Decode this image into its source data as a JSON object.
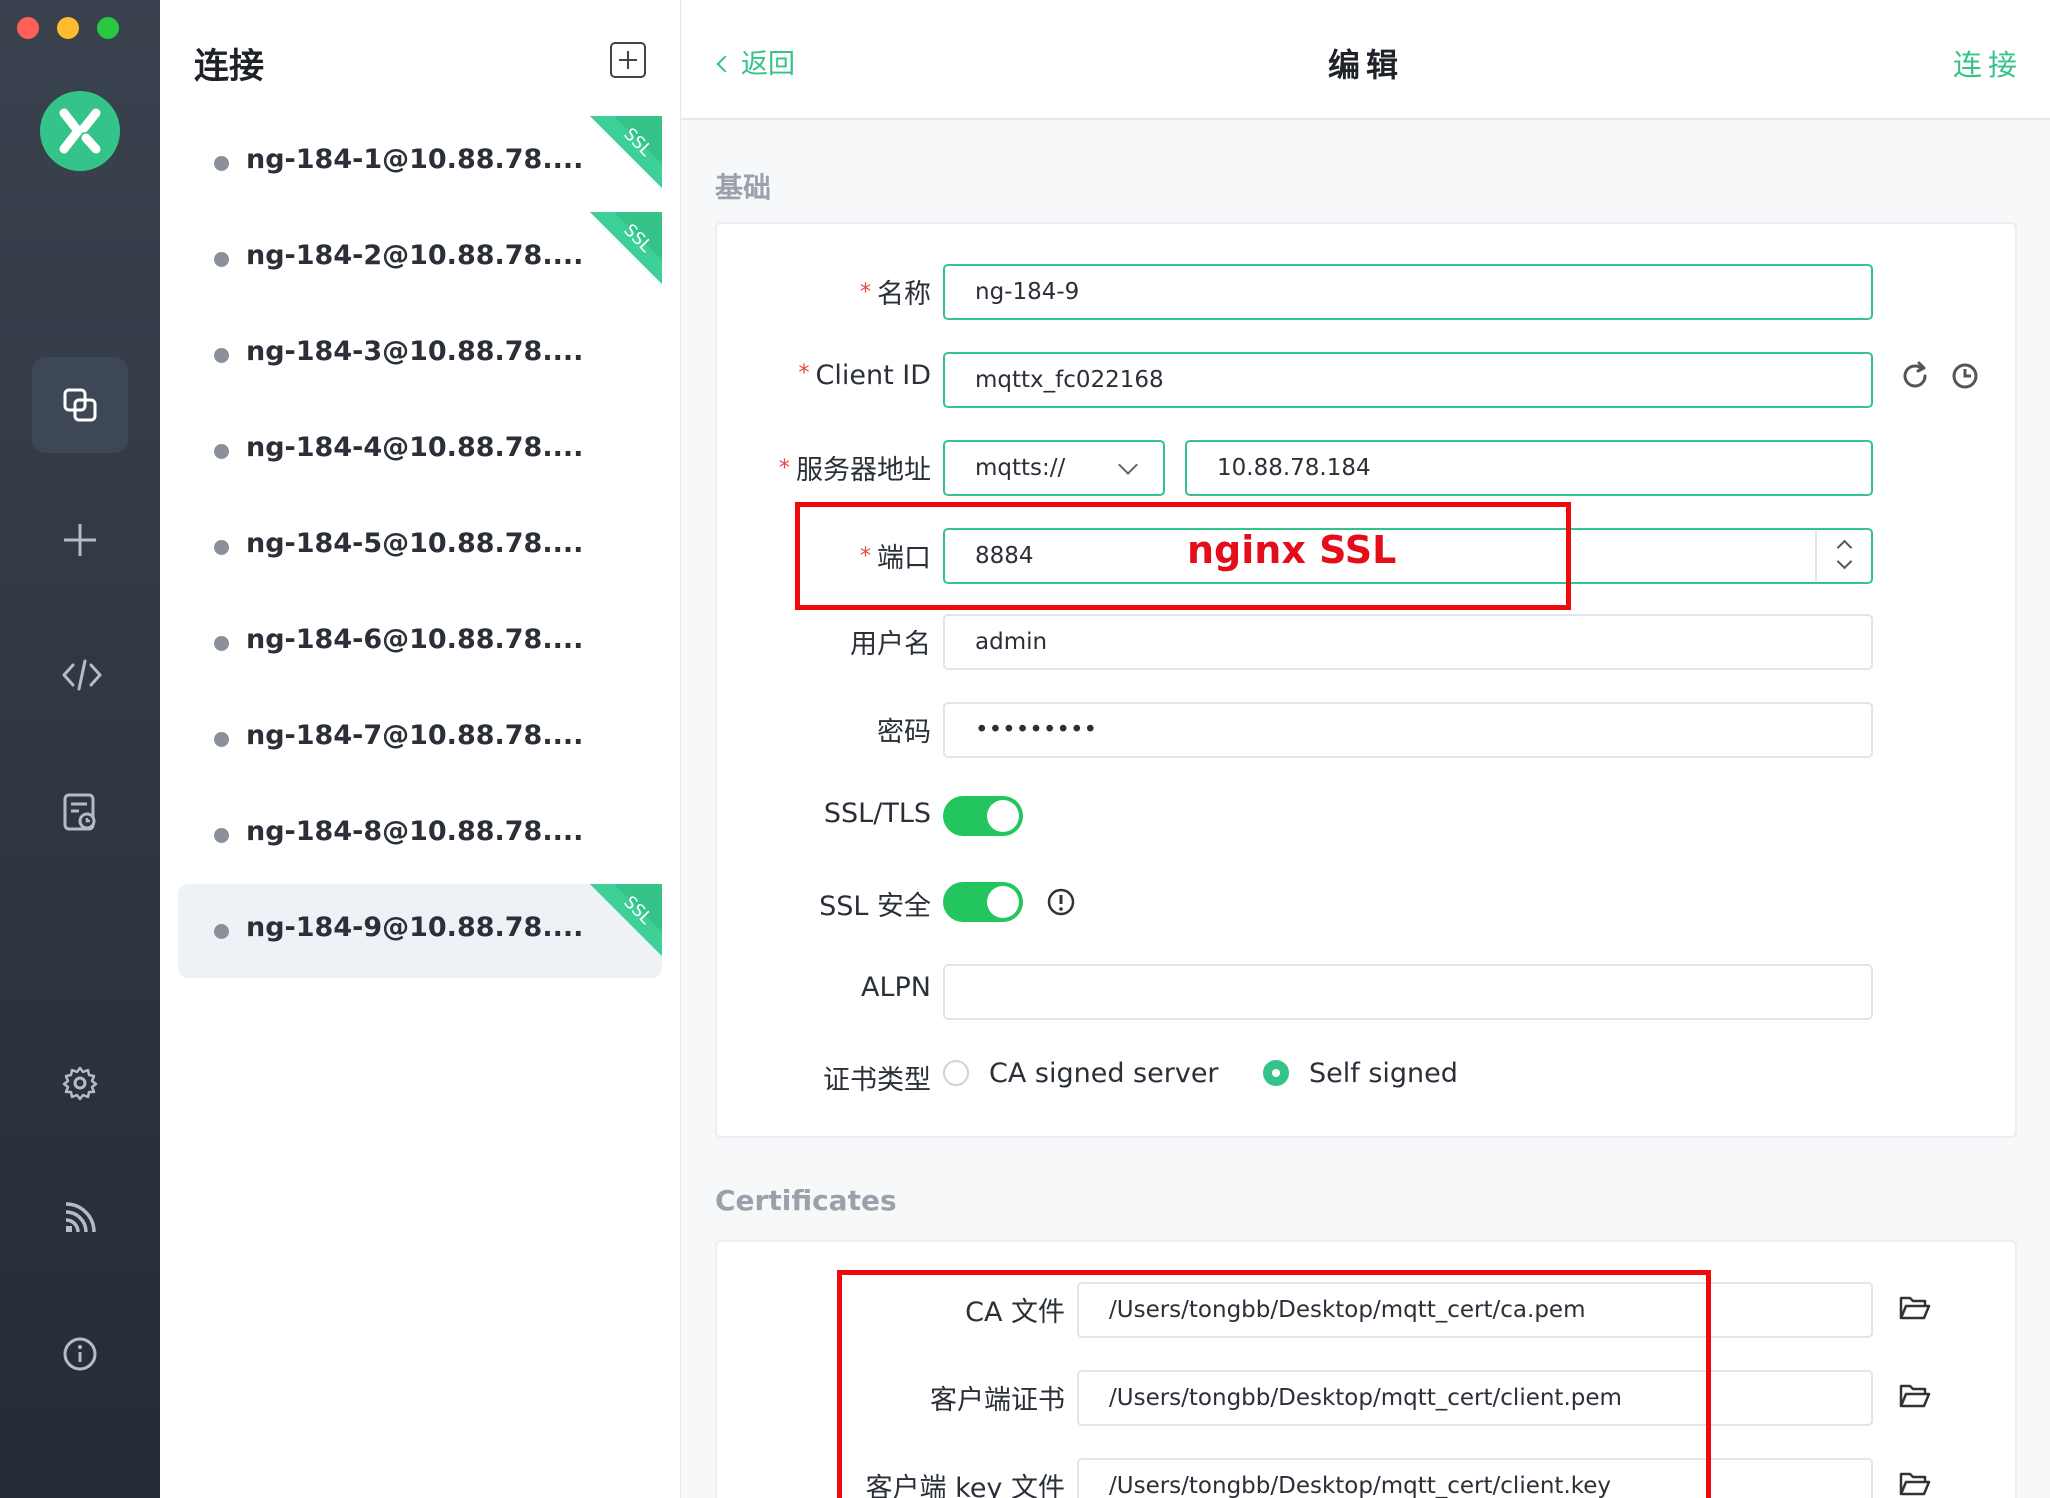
{
  "window": {
    "controls": [
      "close",
      "minimize",
      "maximize"
    ]
  },
  "rail": {
    "logo_icon": "mqttx-logo",
    "items": [
      {
        "name": "connections-icon",
        "active": true
      },
      {
        "name": "plus-icon",
        "active": false
      },
      {
        "name": "code-icon",
        "active": false
      },
      {
        "name": "log-icon",
        "active": false
      },
      {
        "name": "settings-icon",
        "active": false
      },
      {
        "name": "feed-icon",
        "active": false
      },
      {
        "name": "info-icon",
        "active": false
      }
    ]
  },
  "list": {
    "title": "连接",
    "new_button_icon": "new-window-icon",
    "connections": [
      {
        "name": "ng-184-1@10.88.78....",
        "ssl": true,
        "active": false
      },
      {
        "name": "ng-184-2@10.88.78....",
        "ssl": true,
        "active": false
      },
      {
        "name": "ng-184-3@10.88.78....",
        "ssl": false,
        "active": false
      },
      {
        "name": "ng-184-4@10.88.78....",
        "ssl": false,
        "active": false
      },
      {
        "name": "ng-184-5@10.88.78....",
        "ssl": false,
        "active": false
      },
      {
        "name": "ng-184-6@10.88.78....",
        "ssl": false,
        "active": false
      },
      {
        "name": "ng-184-7@10.88.78....",
        "ssl": false,
        "active": false
      },
      {
        "name": "ng-184-8@10.88.78....",
        "ssl": false,
        "active": false
      },
      {
        "name": "ng-184-9@10.88.78....",
        "ssl": true,
        "active": true
      }
    ],
    "ssl_badge": "SSL"
  },
  "header": {
    "back_label": "返回",
    "title": "编辑",
    "connect_label": "连接"
  },
  "basic": {
    "section_title": "基础",
    "name_label": "名称",
    "name_value": "ng-184-9",
    "client_id_label": "Client ID",
    "client_id_value": "mqttx_fc022168",
    "host_label": "服务器地址",
    "protocol_value": "mqtts://",
    "host_value": "10.88.78.184",
    "port_label": "端口",
    "port_value": "8884",
    "username_label": "用户名",
    "username_value": "admin",
    "password_label": "密码",
    "password_value": "•••••••••",
    "ssl_tls_label": "SSL/TLS",
    "ssl_tls_on": true,
    "ssl_secure_label": "SSL 安全",
    "ssl_secure_on": true,
    "alpn_label": "ALPN",
    "alpn_value": "",
    "cert_type_label": "证书类型",
    "cert_options": [
      "CA signed server",
      "Self signed"
    ],
    "cert_selected": "Self signed",
    "required_mark": "*"
  },
  "annotation": {
    "port_note": "nginx SSL",
    "color": "#e30e1a"
  },
  "certificates": {
    "section_title": "Certificates",
    "ca_label": "CA 文件",
    "ca_value": "/Users/tongbb/Desktop/mqtt_cert/ca.pem",
    "client_cert_label": "客户端证书",
    "client_cert_value": "/Users/tongbb/Desktop/mqtt_cert/client.pem",
    "client_key_label": "客户端 key 文件",
    "client_key_value": "/Users/tongbb/Desktop/mqtt_cert/client.key",
    "file_icon": "folder-open-icon"
  },
  "colors": {
    "accent": "#34c388",
    "rail_bg": "#2c3341",
    "toggle_on": "#22c55e",
    "required": "#e6453a"
  }
}
